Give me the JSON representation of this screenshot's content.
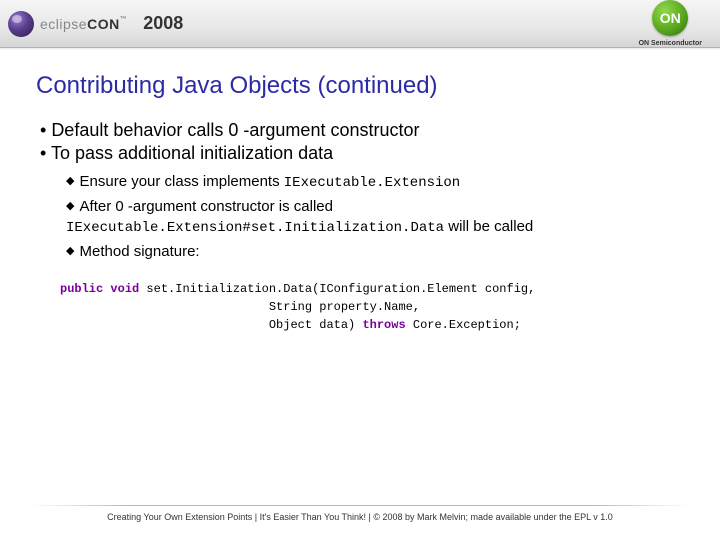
{
  "header": {
    "brand_prefix": "eclipse",
    "brand_suffix": "CON",
    "tm": "™",
    "year": "2008",
    "on_text": "ON",
    "on_label": "ON Semiconductor"
  },
  "slide": {
    "title": "Contributing Java Objects (continued)",
    "b1": "Default behavior calls 0 -argument constructor",
    "b2": "To pass additional initialization data",
    "s1_pre": "Ensure your class implements ",
    "s1_code": "IExecutable.Extension",
    "s2": "After 0 -argument constructor is called",
    "s2_code": "IExecutable.Extension#set.Initialization.Data",
    "s2_post": " will be called",
    "s3": "Method signature:"
  },
  "code": {
    "kw_public": "public",
    "kw_void": "void",
    "line1_rest": " set.Initialization.Data(IConfiguration.Element config,",
    "line2": "                             String property.Name,",
    "line3_pre": "                             Object data) ",
    "kw_throws": "throws",
    "line3_post": " Core.Exception;"
  },
  "footer": "Creating Your Own Extension Points  |  It's Easier Than You Think!  |  © 2008 by Mark Melvin; made available under the EPL v 1.0"
}
